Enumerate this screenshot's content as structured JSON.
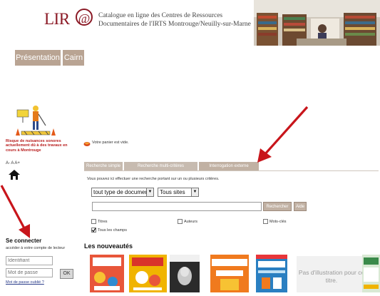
{
  "header": {
    "logo": "LIR@",
    "catalogue_title_line1": "Catalogue en ligne des Centres de Ressources",
    "catalogue_title_line2": "Documentaires de l'IRTS Montrouge/Neuilly-sur-Marne"
  },
  "nav": {
    "items": [
      {
        "label": "Présentation"
      },
      {
        "label": "Cairn"
      }
    ]
  },
  "sidebar": {
    "warning_text": "Risque de nuisances sonores actuellement dû à des travaux en cours à Montrouge",
    "font_size_control": "A- A A+",
    "login": {
      "title": "Se connecter",
      "note": "accéder à votre compte de lecteur",
      "identifier_placeholder": "Identifiant",
      "password_placeholder": "Mot de passe",
      "ok_label": "OK",
      "forgot_label": "Mot de passe oublié ?"
    }
  },
  "main": {
    "cart_text": "Votre panier est vide.",
    "tabs": [
      {
        "label": "Recherche simple"
      },
      {
        "label": "Recherche multi-critères"
      },
      {
        "label": "Interrogation externe"
      }
    ],
    "intro": "Vous pouvez ici effectuer une recherche portant sur un ou plusieurs critères.",
    "doc_type_select": "tout type de document",
    "site_select": "Tous sites",
    "search_button": "Rechercher",
    "help_button": "Aide",
    "checkboxes": [
      {
        "label": "Titres",
        "checked": false
      },
      {
        "label": "Auteurs",
        "checked": false
      },
      {
        "label": "Mots-clés",
        "checked": false
      },
      {
        "label": "Tous les champs",
        "checked": true
      }
    ],
    "new_arrivals_title": "Les nouveautés",
    "books": [
      {
        "cover_text": "Créer & jouer",
        "color": "#e8563a"
      },
      {
        "cover_text": "Créer & jouer",
        "color": "#f0b400"
      },
      {
        "cover_text": "ALAIN FINKIELKRAUT",
        "color": "#2b2b2b"
      },
      {
        "cover_text": "APPRENDS-MOI À FAIRE SEUL",
        "color": "#f07a1e"
      },
      {
        "cover_text": "CAFERUIS",
        "color": "#2a7fc1"
      }
    ],
    "no_image_text": "Pas d'illustration pour ce titre."
  },
  "colors": {
    "brand": "#8b1a26",
    "nav_bg": "#b9a493",
    "tab_bg": "#c7bbb0",
    "arrow": "#c8151b"
  }
}
